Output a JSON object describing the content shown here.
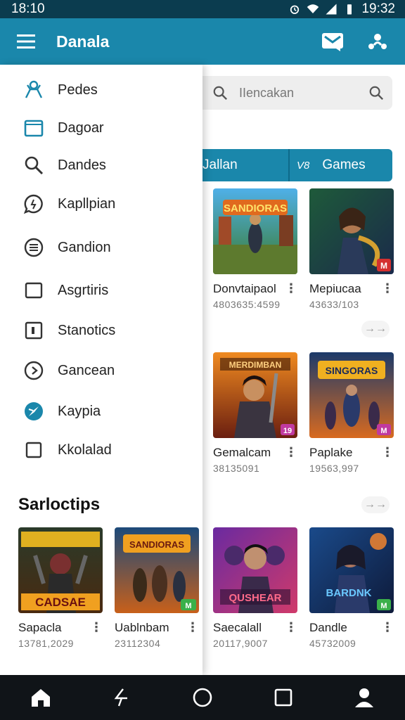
{
  "status": {
    "time_left": "18:10",
    "time_right": "19:32"
  },
  "app_bar": {
    "title": "Danala"
  },
  "search": {
    "placeholder": "IIencakan"
  },
  "tabs": [
    {
      "label": "Jallan"
    },
    {
      "badge": "V8",
      "label": "Games"
    }
  ],
  "drawer": {
    "items": [
      {
        "label": "Pedes",
        "icon": "person-icon",
        "color": "#1a87ab"
      },
      {
        "label": "Dagoar",
        "icon": "folder-icon",
        "color": "#1a87ab"
      },
      {
        "label": "Dandes",
        "icon": "search-icon",
        "color": "#333333"
      },
      {
        "label": "Kapllpian",
        "icon": "chat-icon",
        "color": "#333333"
      },
      {
        "label": "Gandion",
        "icon": "list-circle-icon",
        "color": "#333333"
      },
      {
        "label": "Asgrtiris",
        "icon": "square-icon",
        "color": "#333333"
      },
      {
        "label": "Stanotics",
        "icon": "box-icon",
        "color": "#333333"
      },
      {
        "label": "Gancean",
        "icon": "play-circle-icon",
        "color": "#333333"
      },
      {
        "label": "Kaypia",
        "icon": "compass-icon",
        "color": "#1a87ab"
      },
      {
        "label": "Kkolalad",
        "icon": "checkbox-icon",
        "color": "#333333"
      }
    ],
    "section_title": "Sarloctips"
  },
  "games": [
    {
      "title": "Donvtaipaol",
      "meta": "4803635:4599",
      "art": "SANDIORAS",
      "badge": ""
    },
    {
      "title": "Mepiucaa",
      "meta": "43633/103",
      "art": "",
      "badge": "M"
    },
    {
      "title": "Gemalcam",
      "meta": "38135091",
      "art": "MERDIMBAN",
      "badge": "19"
    },
    {
      "title": "Paplake",
      "meta": "19563,997",
      "art": "SINGORAS",
      "badge": "M"
    },
    {
      "title": "Saecalall",
      "meta": "20117,9007",
      "art": "QUSHEAR",
      "badge": ""
    },
    {
      "title": "Dandle",
      "meta": "45732009",
      "art": "BARDNK",
      "badge": "M"
    },
    {
      "title": "Sapacla",
      "meta": "13781,2029",
      "art": "CADSAE",
      "badge": ""
    },
    {
      "title": "Uablnbam",
      "meta": "23112304",
      "art": "SANDIORAS",
      "badge": "M"
    }
  ],
  "more_glyph": "⋮",
  "arrow_glyph": "→→",
  "colors": {
    "primary": "#1a87ab",
    "status_bar": "#0b3c4f",
    "nav_bar": "#101418"
  }
}
